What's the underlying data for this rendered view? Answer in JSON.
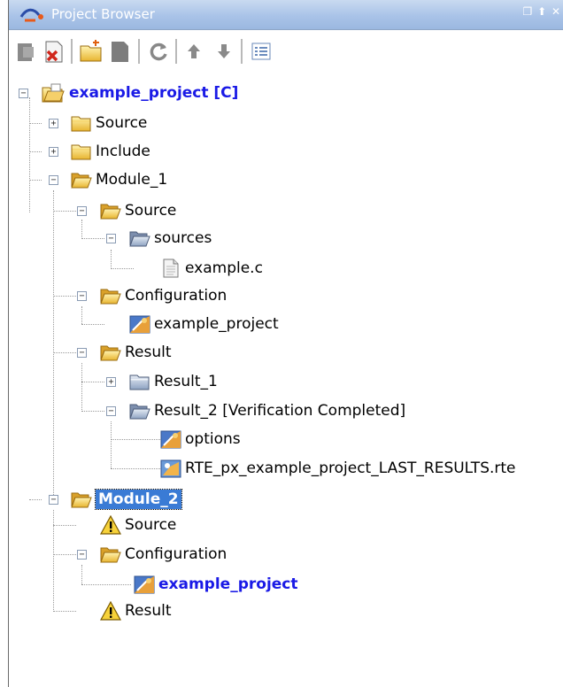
{
  "panel": {
    "title": "Project Browser",
    "window_controls": "❐ ⬆ ✕"
  },
  "toolbar": {
    "buttons": [
      "new-project-icon",
      "close-project-icon",
      "new-folder-icon",
      "properties-icon",
      "refresh-icon",
      "move-up-icon",
      "move-down-icon",
      "list-view-icon"
    ]
  },
  "tree": {
    "root": "example_project [C]",
    "source": "Source",
    "include": "Include",
    "module1": "Module_1",
    "m1_source": "Source",
    "m1_sources": "sources",
    "m1_file": "example.c",
    "m1_config": "Configuration",
    "m1_config_item": "example_project",
    "m1_result": "Result",
    "m1_result1": "Result_1",
    "m1_result2": "Result_2 [Verification Completed]",
    "m1_options": "options",
    "m1_rte": "RTE_px_example_project_LAST_RESULTS.rte",
    "module2": "Module_2",
    "m2_source": "Source",
    "m2_config": "Configuration",
    "m2_config_item": "example_project",
    "m2_result": "Result"
  },
  "colors": {
    "title_bg": "#a9c3e8",
    "selection": "#3a7bd5",
    "active_link": "#1a1ae6"
  }
}
